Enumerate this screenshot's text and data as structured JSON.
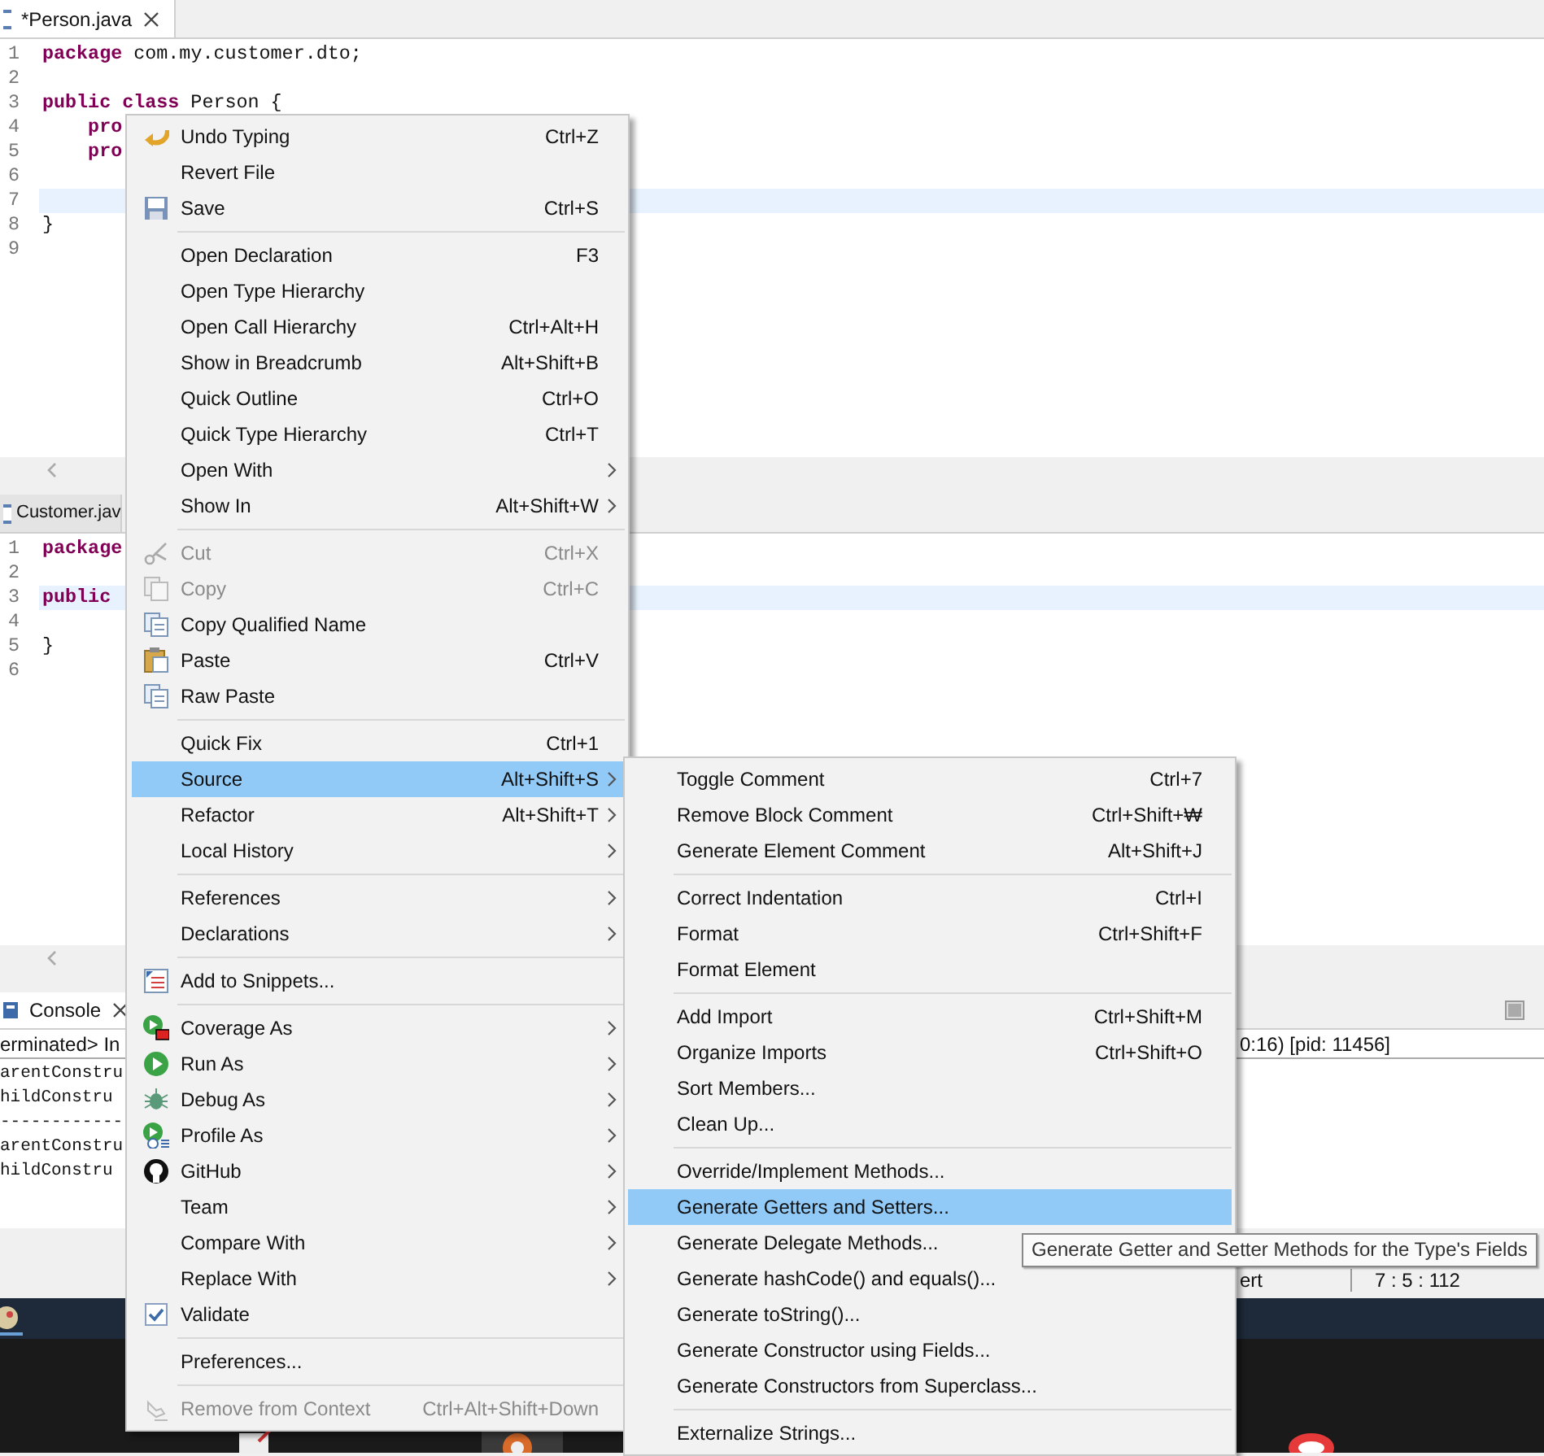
{
  "editors": [
    {
      "tab": {
        "label": "*Person.java",
        "selected": true
      },
      "lines": [
        {
          "number": "1",
          "current": false,
          "tokens": [
            {
              "text": "package",
              "keyword": true
            },
            {
              "text": " com.my.customer.dto;",
              "keyword": false
            }
          ]
        },
        {
          "number": "2",
          "current": false
        },
        {
          "number": "3",
          "current": false,
          "tokens": [
            {
              "text": "public class",
              "keyword": true
            },
            {
              "text": " Person {",
              "keyword": false
            }
          ]
        },
        {
          "number": "4",
          "current": false,
          "tokens": [
            {
              "text": "    pro",
              "keyword": true
            }
          ]
        },
        {
          "number": "5",
          "current": false,
          "tokens": [
            {
              "text": "    pro",
              "keyword": true
            }
          ]
        },
        {
          "number": "6",
          "current": false
        },
        {
          "number": "7",
          "current": true
        },
        {
          "number": "8",
          "current": false,
          "tokens": [
            {
              "text": "}",
              "keyword": false
            }
          ]
        },
        {
          "number": "9",
          "current": false
        }
      ]
    },
    {
      "tab": {
        "label": "Customer.jav",
        "selected": false
      },
      "lines": [
        {
          "number": "1",
          "current": false,
          "tokens": [
            {
              "text": "package",
              "keyword": true
            }
          ]
        },
        {
          "number": "2",
          "current": false
        },
        {
          "number": "3",
          "current": true,
          "tokens": [
            {
              "text": "public",
              "keyword": true
            }
          ]
        },
        {
          "number": "4",
          "current": false
        },
        {
          "number": "5",
          "current": false,
          "tokens": [
            {
              "text": "}",
              "keyword": false
            }
          ]
        },
        {
          "number": "6",
          "current": false
        }
      ]
    }
  ],
  "console": {
    "tab": "Console",
    "status": "erminated> In",
    "status_end": "0:16) [pid: 11456]",
    "lines": [
      "arentConstru",
      "hildConstru",
      "------------",
      "arentConstru",
      "hildConstru"
    ]
  },
  "status_bar": {
    "mode": "ert",
    "position": "7 : 5 : 112"
  },
  "menu": {
    "items": [
      {
        "kind": "item",
        "label": "Undo Typing",
        "shortcut": "Ctrl+Z",
        "submenu": false,
        "disabled": false,
        "selected": false
      },
      {
        "kind": "item",
        "label": "Revert File",
        "submenu": false,
        "disabled": false,
        "selected": false
      },
      {
        "kind": "item",
        "label": "Save",
        "shortcut": "Ctrl+S",
        "submenu": false,
        "disabled": false,
        "selected": false
      },
      {
        "kind": "separator"
      },
      {
        "kind": "item",
        "label": "Open Declaration",
        "shortcut": "F3",
        "submenu": false,
        "disabled": false,
        "selected": false
      },
      {
        "kind": "item",
        "label": "Open Type Hierarchy",
        "submenu": false,
        "disabled": false,
        "selected": false
      },
      {
        "kind": "item",
        "label": "Open Call Hierarchy",
        "shortcut": "Ctrl+Alt+H",
        "submenu": false,
        "disabled": false,
        "selected": false
      },
      {
        "kind": "item",
        "label": "Show in Breadcrumb",
        "shortcut": "Alt+Shift+B",
        "submenu": false,
        "disabled": false,
        "selected": false
      },
      {
        "kind": "item",
        "label": "Quick Outline",
        "shortcut": "Ctrl+O",
        "submenu": false,
        "disabled": false,
        "selected": false
      },
      {
        "kind": "item",
        "label": "Quick Type Hierarchy",
        "shortcut": "Ctrl+T",
        "submenu": false,
        "disabled": false,
        "selected": false
      },
      {
        "kind": "item",
        "label": "Open With",
        "submenu": true,
        "disabled": false,
        "selected": false
      },
      {
        "kind": "item",
        "label": "Show In",
        "shortcut": "Alt+Shift+W",
        "submenu": true,
        "disabled": false,
        "selected": false
      },
      {
        "kind": "separator"
      },
      {
        "kind": "item",
        "label": "Cut",
        "shortcut": "Ctrl+X",
        "submenu": false,
        "disabled": true,
        "selected": false
      },
      {
        "kind": "item",
        "label": "Copy",
        "shortcut": "Ctrl+C",
        "submenu": false,
        "disabled": true,
        "selected": false
      },
      {
        "kind": "item",
        "label": "Copy Qualified Name",
        "submenu": false,
        "disabled": false,
        "selected": false
      },
      {
        "kind": "item",
        "label": "Paste",
        "shortcut": "Ctrl+V",
        "submenu": false,
        "disabled": false,
        "selected": false
      },
      {
        "kind": "item",
        "label": "Raw Paste",
        "submenu": false,
        "disabled": false,
        "selected": false
      },
      {
        "kind": "separator"
      },
      {
        "kind": "item",
        "label": "Quick Fix",
        "shortcut": "Ctrl+1",
        "submenu": false,
        "disabled": false,
        "selected": false
      },
      {
        "kind": "item",
        "label": "Source",
        "shortcut": "Alt+Shift+S",
        "submenu": true,
        "disabled": false,
        "selected": true
      },
      {
        "kind": "item",
        "label": "Refactor",
        "shortcut": "Alt+Shift+T",
        "submenu": true,
        "disabled": false,
        "selected": false
      },
      {
        "kind": "item",
        "label": "Local History",
        "submenu": true,
        "disabled": false,
        "selected": false
      },
      {
        "kind": "separator"
      },
      {
        "kind": "item",
        "label": "References",
        "submenu": true,
        "disabled": false,
        "selected": false
      },
      {
        "kind": "item",
        "label": "Declarations",
        "submenu": true,
        "disabled": false,
        "selected": false
      },
      {
        "kind": "separator"
      },
      {
        "kind": "item",
        "label": "Add to Snippets...",
        "submenu": false,
        "disabled": false,
        "selected": false
      },
      {
        "kind": "separator"
      },
      {
        "kind": "item",
        "label": "Coverage As",
        "submenu": true,
        "disabled": false,
        "selected": false
      },
      {
        "kind": "item",
        "label": "Run As",
        "submenu": true,
        "disabled": false,
        "selected": false
      },
      {
        "kind": "item",
        "label": "Debug As",
        "submenu": true,
        "disabled": false,
        "selected": false
      },
      {
        "kind": "item",
        "label": "Profile As",
        "submenu": true,
        "disabled": false,
        "selected": false
      },
      {
        "kind": "item",
        "label": "GitHub",
        "submenu": true,
        "disabled": false,
        "selected": false
      },
      {
        "kind": "item",
        "label": "Team",
        "submenu": true,
        "disabled": false,
        "selected": false
      },
      {
        "kind": "item",
        "label": "Compare With",
        "submenu": true,
        "disabled": false,
        "selected": false
      },
      {
        "kind": "item",
        "label": "Replace With",
        "submenu": true,
        "disabled": false,
        "selected": false
      },
      {
        "kind": "check",
        "label": "Validate",
        "checked": true,
        "submenu": false,
        "disabled": false,
        "selected": false
      },
      {
        "kind": "separator"
      },
      {
        "kind": "item",
        "label": "Preferences...",
        "submenu": false,
        "disabled": false,
        "selected": false
      },
      {
        "kind": "separator"
      },
      {
        "kind": "item",
        "label": "Remove from Context",
        "shortcut": "Ctrl+Alt+Shift+Down",
        "submenu": false,
        "disabled": true,
        "selected": false
      }
    ]
  },
  "submenu": {
    "items": [
      {
        "kind": "item",
        "label": "Toggle Comment",
        "shortcut": "Ctrl+7",
        "selected": false
      },
      {
        "kind": "item",
        "label": "Remove Block Comment",
        "shortcut": "Ctrl+Shift+₩",
        "selected": false
      },
      {
        "kind": "item",
        "label": "Generate Element Comment",
        "shortcut": "Alt+Shift+J",
        "selected": false
      },
      {
        "kind": "separator"
      },
      {
        "kind": "item",
        "label": "Correct Indentation",
        "shortcut": "Ctrl+I",
        "selected": false
      },
      {
        "kind": "item",
        "label": "Format",
        "shortcut": "Ctrl+Shift+F",
        "selected": false
      },
      {
        "kind": "item",
        "label": "Format Element",
        "selected": false
      },
      {
        "kind": "separator"
      },
      {
        "kind": "item",
        "label": "Add Import",
        "shortcut": "Ctrl+Shift+M",
        "selected": false
      },
      {
        "kind": "item",
        "label": "Organize Imports",
        "shortcut": "Ctrl+Shift+O",
        "selected": false
      },
      {
        "kind": "item",
        "label": "Sort Members...",
        "selected": false
      },
      {
        "kind": "item",
        "label": "Clean Up...",
        "selected": false
      },
      {
        "kind": "separator"
      },
      {
        "kind": "item",
        "label": "Override/Implement Methods...",
        "selected": false
      },
      {
        "kind": "item",
        "label": "Generate Getters and Setters...",
        "selected": true
      },
      {
        "kind": "item",
        "label": "Generate Delegate Methods...",
        "selected": false
      },
      {
        "kind": "item",
        "label": "Generate hashCode() and equals()...",
        "selected": false
      },
      {
        "kind": "item",
        "label": "Generate toString()...",
        "selected": false
      },
      {
        "kind": "item",
        "label": "Generate Constructor using Fields...",
        "selected": false
      },
      {
        "kind": "item",
        "label": "Generate Constructors from Superclass...",
        "selected": false
      },
      {
        "kind": "separator"
      },
      {
        "kind": "item",
        "label": "Externalize Strings...",
        "selected": false
      }
    ]
  },
  "tooltip": "Generate Getter and Setter Methods for the Type's Fields"
}
